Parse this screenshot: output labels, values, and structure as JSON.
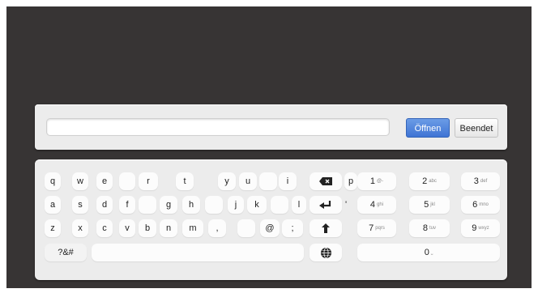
{
  "dialog": {
    "url_value": "",
    "open_label": "Öffnen",
    "close_label": "Beendet"
  },
  "keyboard": {
    "row1": [
      "q",
      "w",
      "e",
      "r",
      "t",
      "y",
      "u",
      "i",
      "p"
    ],
    "row2": [
      "a",
      "s",
      "d",
      "f",
      "g",
      "h",
      "j",
      "k",
      "l",
      "'"
    ],
    "row3": [
      "z",
      "x",
      "c",
      "v",
      "b",
      "n",
      "m",
      ",",
      "@",
      ";"
    ],
    "symbols_label": "?&#",
    "numpad": [
      {
        "digit": "1",
        "sub": "@-"
      },
      {
        "digit": "2",
        "sub": "abc"
      },
      {
        "digit": "3",
        "sub": "def"
      },
      {
        "digit": "4",
        "sub": "ghi"
      },
      {
        "digit": "5",
        "sub": "jkl"
      },
      {
        "digit": "6",
        "sub": "mno"
      },
      {
        "digit": "7",
        "sub": "pqrs"
      },
      {
        "digit": "8",
        "sub": "tuv"
      },
      {
        "digit": "9",
        "sub": "wxyz"
      },
      {
        "digit": "0",
        "sub": "⎵"
      }
    ],
    "icons": {
      "backspace": "backspace-icon",
      "enter": "enter-icon",
      "shift": "shift-icon",
      "globe": "globe-icon"
    }
  },
  "colors": {
    "background": "#373434",
    "panel": "#ececec",
    "open_button": "#4a80da"
  }
}
